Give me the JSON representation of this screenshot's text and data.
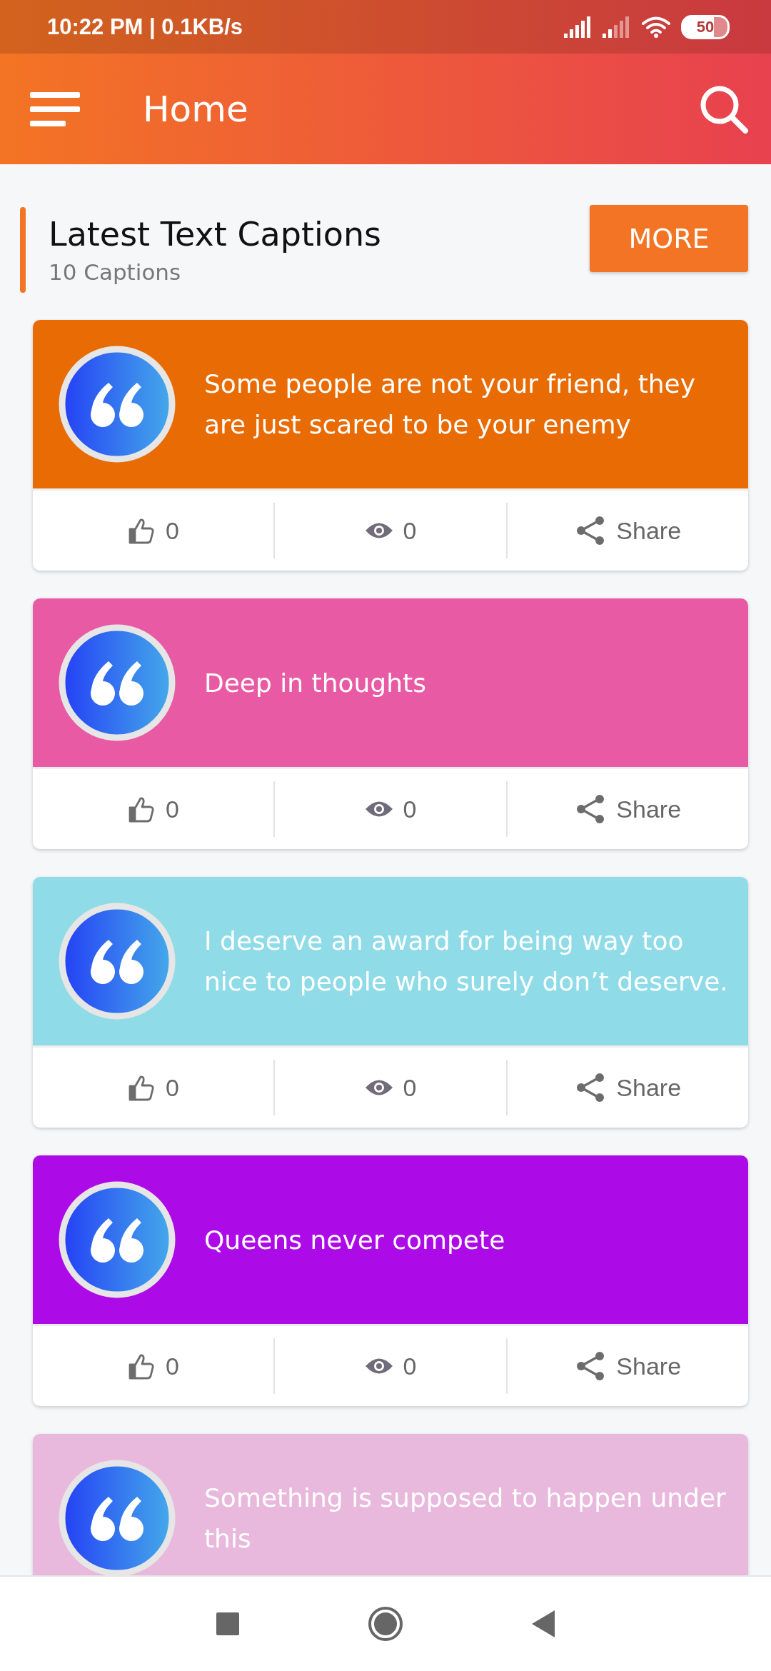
{
  "status_bar": {
    "time": "10:22 PM | 0.1KB/s",
    "battery": "50"
  },
  "app_bar": {
    "title": "Home"
  },
  "section": {
    "title": "Latest Text Captions",
    "count": "10 Captions",
    "button": "MORE"
  },
  "captions": [
    {
      "text": "Some people are not your friend, they are just scared to be your enemy",
      "color": "#e86b04",
      "likes": "0",
      "views": "0",
      "share": "Share"
    },
    {
      "text": "Deep in thoughts",
      "color": "#e95aa5",
      "likes": "0",
      "views": "0",
      "share": "Share"
    },
    {
      "text": "I deserve an award for being way too nice to people who surely don’t deserve.",
      "color": "#8fdce8",
      "likes": "0",
      "views": "0",
      "share": "Share"
    },
    {
      "text": "Queens never compete",
      "color": "#ad0ae8",
      "likes": "0",
      "views": "0",
      "share": "Share"
    },
    {
      "text": "Something is supposed to happen under this",
      "color": "#e8b9dc"
    }
  ]
}
